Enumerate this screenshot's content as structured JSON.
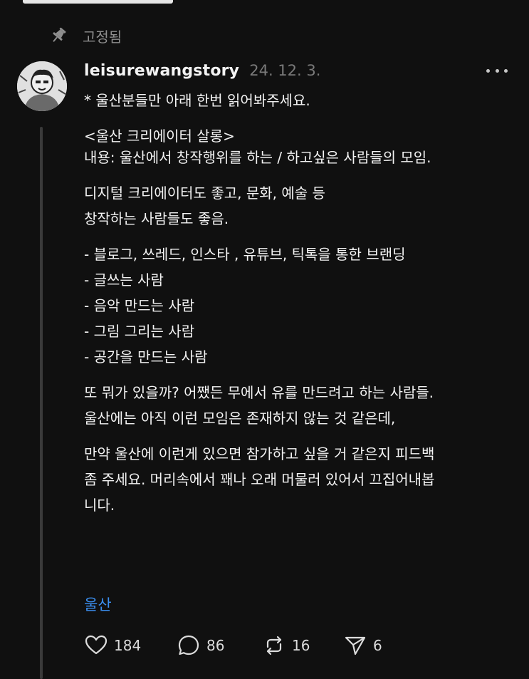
{
  "pinned": {
    "label": "고정됨"
  },
  "post": {
    "username": "leisurewangstory",
    "timestamp": "24. 12. 3.",
    "lines": [
      "* 울산분들만 아래 한번 읽어봐주세요.",
      "<울산 크리에이터 살롱>",
      "내용: 울산에서 창작행위를 하는 / 하고싶은 사람들의 모임.",
      "디지털 크리에이터도 좋고, 문화, 예술 등",
      "창작하는 사람들도 좋음.",
      "- 블로그, 쓰레드, 인스타 , 유튜브, 틱톡을 통한 브랜딩",
      "- 글쓰는 사람",
      "- 음악 만드는 사람",
      "- 그림 그리는 사람",
      "- 공간을 만드는 사람",
      "또 뭐가 있을까? 어쨌든 무에서 유를 만드려고 하는 사람들.",
      "울산에는 아직 이런 모임은 존재하지 않는 것 같은데,",
      "만약 울산에 이런게 있으면 참가하고 싶을 거 같은지 피드백",
      "좀 주세요. 머리속에서 꽤나 오래 머물러 있어서 끄집어내봅",
      "니다."
    ],
    "tag": "울산"
  },
  "actions": {
    "likes": "184",
    "replies": "86",
    "reposts": "16",
    "shares": "6"
  },
  "icons": {
    "pinned": "pin-icon",
    "more": "more-horizontal-icon",
    "like": "heart-icon",
    "reply": "speech-bubble-icon",
    "repost": "repost-arrows-icon",
    "share": "paper-plane-icon"
  },
  "colors": {
    "background": "#101010",
    "text": "#f3f3f3",
    "muted": "#7a7a7a",
    "tag": "#3b8ff0"
  }
}
